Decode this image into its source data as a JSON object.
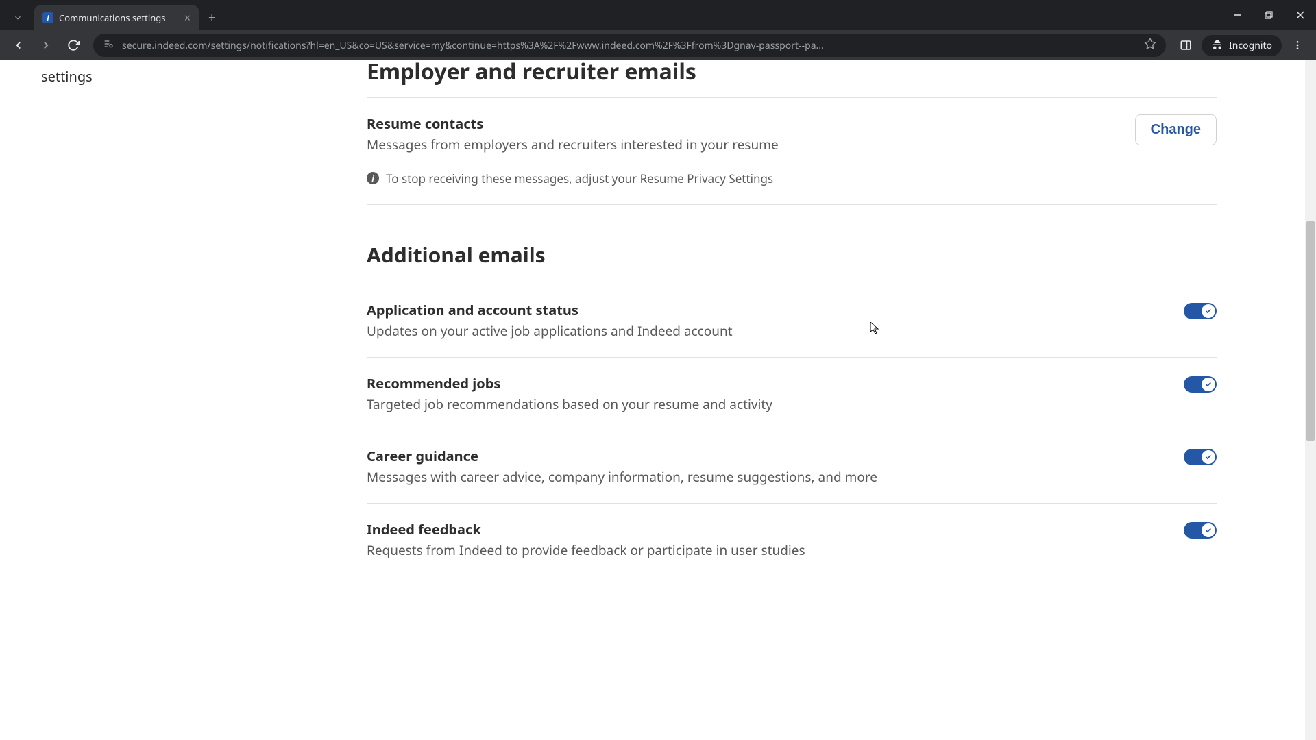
{
  "browser": {
    "tab_title": "Communications settings",
    "url": "secure.indeed.com/settings/notifications?hl=en_US&co=US&service=my&continue=https%3A%2F%2Fwww.indeed.com%2F%3Ffrom%3Dgnav-passport--pa...",
    "incognito_label": "Incognito"
  },
  "sidebar": {
    "label": "settings"
  },
  "sections": {
    "employer": {
      "header": "Employer and recruiter emails",
      "resume_contacts": {
        "title": "Resume contacts",
        "desc": "Messages from employers and recruiters interested in your resume",
        "button": "Change"
      },
      "info_prefix": "To stop receiving these messages, adjust your ",
      "info_link": "Resume Privacy Settings"
    },
    "additional": {
      "header": "Additional emails",
      "items": [
        {
          "title": "Application and account status",
          "desc": "Updates on your active job applications and Indeed account",
          "on": true
        },
        {
          "title": "Recommended jobs",
          "desc": "Targeted job recommendations based on your resume and activity",
          "on": true
        },
        {
          "title": "Career guidance",
          "desc": "Messages with career advice, company information, resume suggestions, and more",
          "on": true
        },
        {
          "title": "Indeed feedback",
          "desc": "Requests from Indeed to provide feedback or participate in user studies",
          "on": true
        }
      ]
    }
  }
}
